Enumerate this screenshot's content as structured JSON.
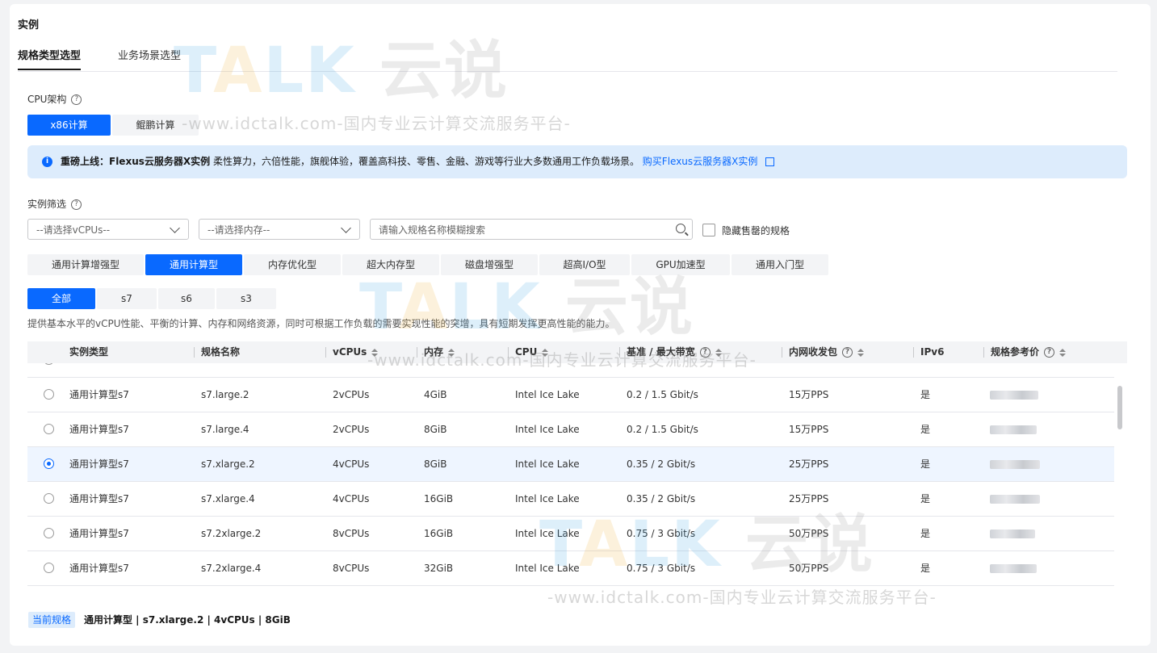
{
  "section_title": "实例",
  "tabs": [
    {
      "label": "规格类型选型",
      "active": true
    },
    {
      "label": "业务场景选型",
      "active": false
    }
  ],
  "cpu_arch": {
    "label": "CPU架构",
    "options": [
      {
        "label": "x86计算",
        "active": true
      },
      {
        "label": "鲲鹏计算",
        "active": false
      }
    ]
  },
  "notice": {
    "bold": "重磅上线：Flexus云服务器X实例",
    "text": " 柔性算力，六倍性能，旗舰体验，覆盖高科技、零售、金融、游戏等行业大多数通用工作负载场景。",
    "link": "购买Flexus云服务器X实例"
  },
  "filter": {
    "label": "实例筛选",
    "vcpu_placeholder": "--请选择vCPUs--",
    "memory_placeholder": "--请选择内存--",
    "search_placeholder": "请输入规格名称模糊搜索",
    "hide_soldout": "隐藏售罄的规格"
  },
  "type_tabs": [
    {
      "label": "通用计算增强型",
      "active": false
    },
    {
      "label": "通用计算型",
      "active": true
    },
    {
      "label": "内存优化型",
      "active": false
    },
    {
      "label": "超大内存型",
      "active": false
    },
    {
      "label": "磁盘增强型",
      "active": false
    },
    {
      "label": "超高I/O型",
      "active": false
    },
    {
      "label": "GPU加速型",
      "active": false
    },
    {
      "label": "通用入门型",
      "active": false
    }
  ],
  "series_tabs": [
    {
      "label": "全部",
      "active": true
    },
    {
      "label": "s7",
      "active": false
    },
    {
      "label": "s6",
      "active": false
    },
    {
      "label": "s3",
      "active": false
    }
  ],
  "description": "提供基本水平的vCPU性能、平衡的计算、内存和网络资源，同时可根据工作负载的需要实现性能的突增，具有短期发挥更高性能的能力。",
  "table": {
    "headers": [
      "实例类型",
      "规格名称",
      "vCPUs",
      "内存",
      "CPU",
      "基准 / 最大带宽",
      "内网收发包",
      "IPv6",
      "规格参考价"
    ],
    "rows": [
      {
        "type": "通用计算型s7",
        "name": "s7.large.2",
        "vcpus": "2vCPUs",
        "mem": "4GiB",
        "cpu": "Intel Ice Lake",
        "bw": "0.2 / 1.5 Gbit/s",
        "pps": "15万PPS",
        "ipv6": "是",
        "selected": false
      },
      {
        "type": "通用计算型s7",
        "name": "s7.large.4",
        "vcpus": "2vCPUs",
        "mem": "8GiB",
        "cpu": "Intel Ice Lake",
        "bw": "0.2 / 1.5 Gbit/s",
        "pps": "15万PPS",
        "ipv6": "是",
        "selected": false
      },
      {
        "type": "通用计算型s7",
        "name": "s7.xlarge.2",
        "vcpus": "4vCPUs",
        "mem": "8GiB",
        "cpu": "Intel Ice Lake",
        "bw": "0.35 / 2 Gbit/s",
        "pps": "25万PPS",
        "ipv6": "是",
        "selected": true
      },
      {
        "type": "通用计算型s7",
        "name": "s7.xlarge.4",
        "vcpus": "4vCPUs",
        "mem": "16GiB",
        "cpu": "Intel Ice Lake",
        "bw": "0.35 / 2 Gbit/s",
        "pps": "25万PPS",
        "ipv6": "是",
        "selected": false
      },
      {
        "type": "通用计算型s7",
        "name": "s7.2xlarge.2",
        "vcpus": "8vCPUs",
        "mem": "16GiB",
        "cpu": "Intel Ice Lake",
        "bw": "0.75 / 3 Gbit/s",
        "pps": "50万PPS",
        "ipv6": "是",
        "selected": false
      },
      {
        "type": "通用计算型s7",
        "name": "s7.2xlarge.4",
        "vcpus": "8vCPUs",
        "mem": "32GiB",
        "cpu": "Intel Ice Lake",
        "bw": "0.75 / 3 Gbit/s",
        "pps": "50万PPS",
        "ipv6": "是",
        "selected": false
      }
    ]
  },
  "current_spec": {
    "badge": "当前规格",
    "value": "通用计算型 | s7.xlarge.2 | 4vCPUs | 8GiB"
  },
  "watermark": {
    "brand": "TALK 云说",
    "url": "-www.idctalk.com-国内专业云计算交流服务平台-"
  },
  "colors": {
    "primary": "#0969ff",
    "notice_bg": "#ddecfc",
    "selected_row": "#eef5ff"
  }
}
